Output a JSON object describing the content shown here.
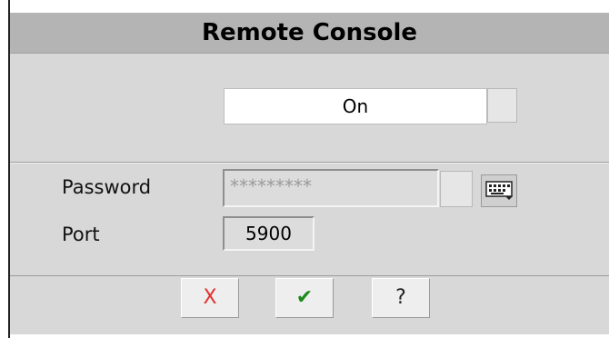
{
  "dialog": {
    "title": "Remote Console"
  },
  "state": {
    "value": "On"
  },
  "password": {
    "label": "Password",
    "value": "*********"
  },
  "port": {
    "label": "Port",
    "value": "5900"
  },
  "footer": {
    "cancel_glyph": "X",
    "ok_glyph": "✔",
    "help_glyph": "?"
  },
  "colors": {
    "title_bar": "#b4b4b4",
    "panel": "#d8d8d8",
    "cancel": "#e03030",
    "ok": "#1a8a1a"
  },
  "icons": {
    "keyboard": "keyboard-icon",
    "cancel": "close-icon",
    "ok": "check-icon",
    "help": "help-icon"
  }
}
